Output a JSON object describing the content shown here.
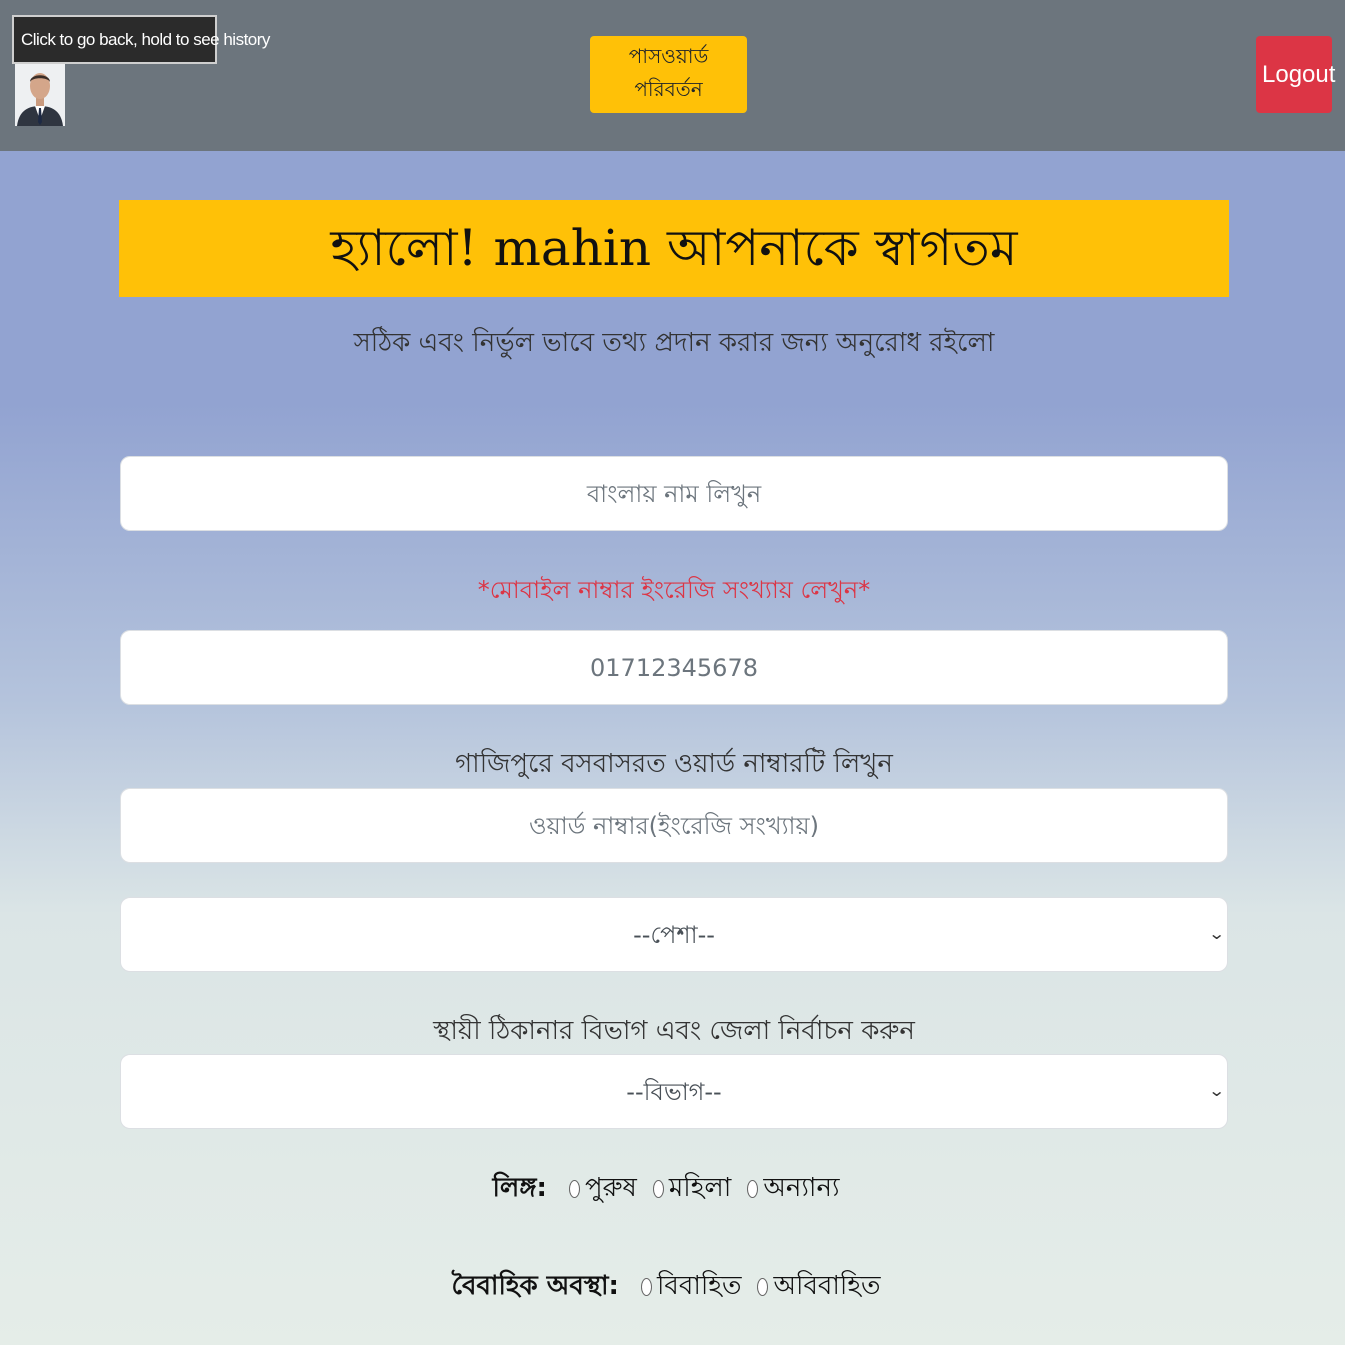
{
  "header": {
    "tooltip": "Click to go back, hold to see history",
    "change_password_label": "পাসওয়ার্ড পরিবর্তন",
    "logout_label": "Logout"
  },
  "welcome": {
    "title": "হ্যালো! mahin আপনাকে স্বাগতম",
    "subtitle": "সঠিক এবং নির্ভুল ভাবে তথ্য প্রদান করার জন্য অনুরোধ রইলো"
  },
  "form": {
    "name_placeholder": "বাংলায় নাম লিখুন",
    "mobile_note": "*মোবাইল নাম্বার ইংরেজি সংখ্যায় লেখুন*",
    "mobile_placeholder": "01712345678",
    "ward_label": "গাজিপুরে বসবাসরত ওয়ার্ড নাম্বারটি লিখুন",
    "ward_placeholder": "ওয়ার্ড নাম্বার(ইংরেজি সংখ্যায়)",
    "profession_selected": "--পেশা--",
    "address_label": "স্থায়ী ঠিকানার বিভাগ এবং জেলা নির্বাচন করুন",
    "division_selected": "--বিভাগ--",
    "gender": {
      "label": "লিঙ্গ:",
      "options": [
        "পুরুষ",
        "মহিলা",
        "অন্যান্য"
      ]
    },
    "marital": {
      "label": "বৈবাহিক অবস্থা:",
      "options": [
        "বিবাহিত",
        "অবিবাহিত"
      ]
    }
  },
  "colors": {
    "topbar": "#6c757d",
    "warning": "#ffc107",
    "danger": "#dc3545"
  }
}
